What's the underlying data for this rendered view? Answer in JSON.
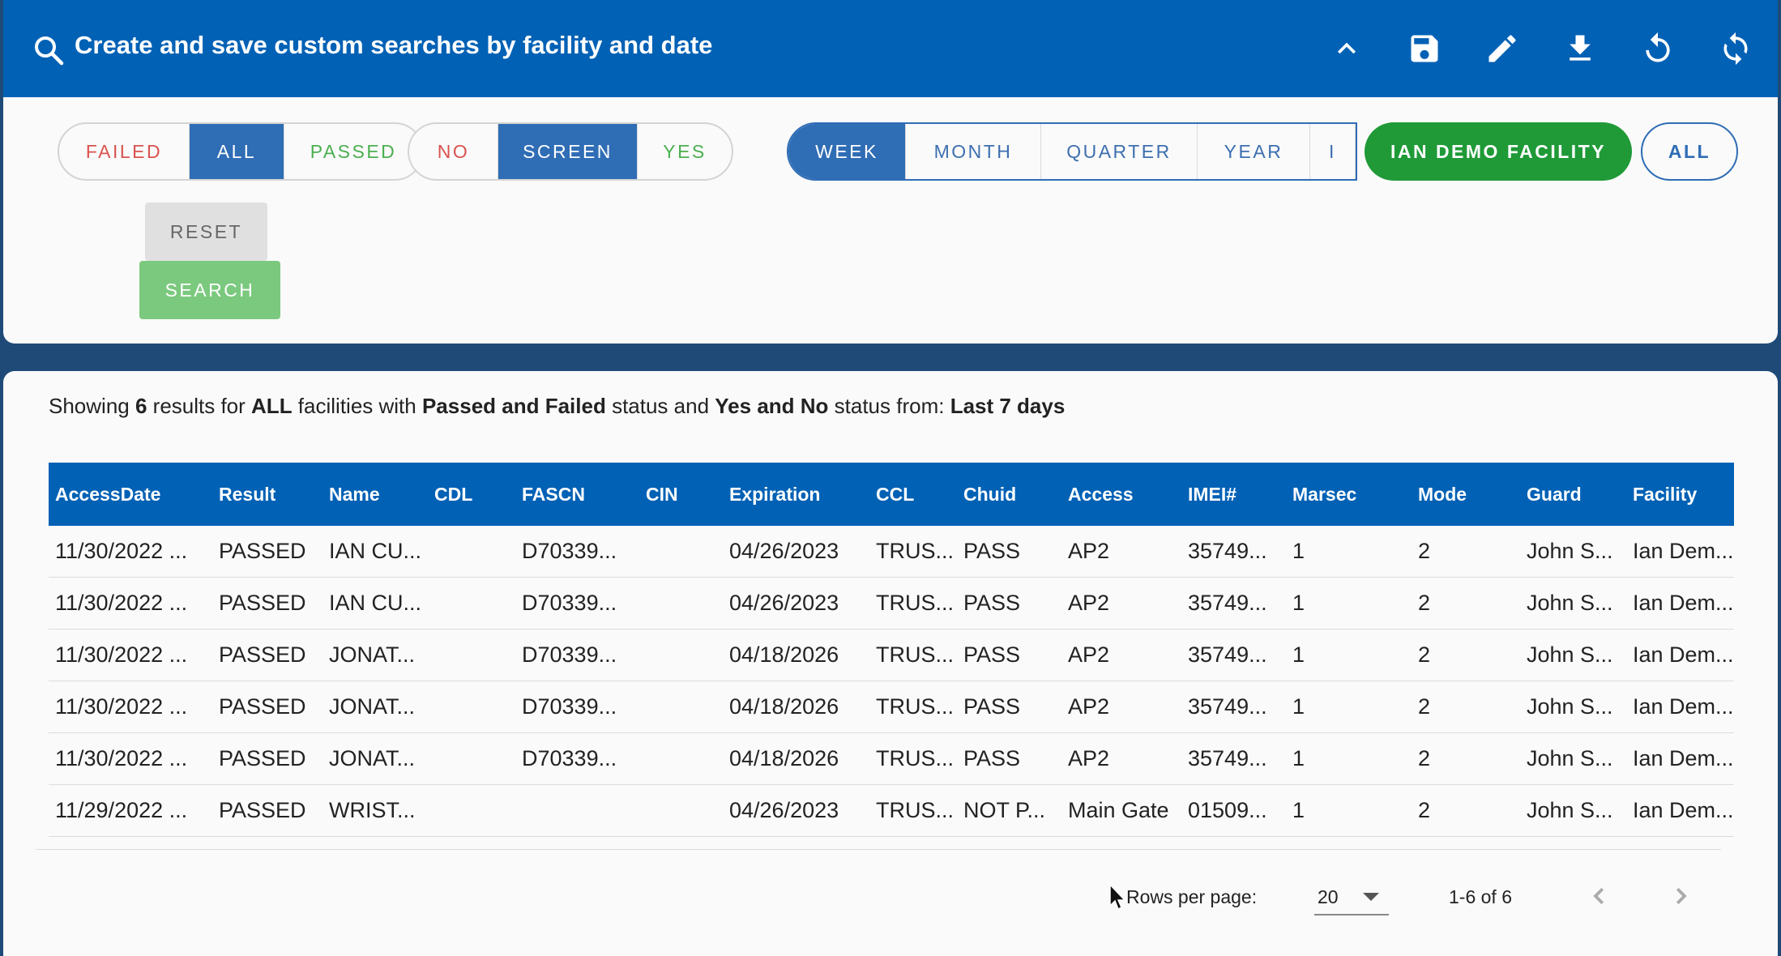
{
  "header": {
    "title": "Create and save custom searches by facility and date",
    "icons": [
      "search-icon",
      "collapse-chevron-icon",
      "save-icon",
      "edit-icon",
      "download-icon",
      "undo-icon",
      "refresh-icon"
    ]
  },
  "filters": {
    "result_group": [
      {
        "label": "FAILED",
        "selected": false,
        "color": "#d9534f"
      },
      {
        "label": "ALL",
        "selected": true
      },
      {
        "label": "PASSED",
        "selected": false,
        "color": "#4caf50"
      }
    ],
    "screen_group": [
      {
        "label": "NO",
        "selected": false,
        "color": "#d9534f"
      },
      {
        "label": "SCREEN",
        "selected": true
      },
      {
        "label": "YES",
        "selected": false,
        "color": "#4caf50"
      }
    ],
    "period_group": [
      {
        "label": "WEEK",
        "selected": true
      },
      {
        "label": "MONTH",
        "selected": false
      },
      {
        "label": "QUARTER",
        "selected": false
      },
      {
        "label": "YEAR",
        "selected": false
      },
      {
        "label": "I",
        "selected": false
      }
    ],
    "facility_label": "IAN DEMO FACILITY",
    "facility_all_label": "ALL",
    "reset_label": "RESET",
    "search_label": "SEARCH"
  },
  "summary": {
    "p1": "Showing ",
    "count": "6",
    "p2": " results for ",
    "facilities": "ALL",
    "p3": " facilities with ",
    "result_status": "Passed and Failed",
    "p4": " status and ",
    "screen_status": "Yes and No",
    "p5": " status from: ",
    "period": "Last 7 days"
  },
  "table": {
    "columns": [
      "AccessDate",
      "Result",
      "Name",
      "CDL",
      "FASCN",
      "CIN",
      "Expiration",
      "CCL",
      "Chuid",
      "Access",
      "IMEI#",
      "Marsec",
      "Mode",
      "Guard",
      "Facility"
    ],
    "rows": [
      [
        "11/30/2022 ...",
        "PASSED",
        "IAN CU...",
        "",
        "D70339...",
        "",
        "04/26/2023",
        "TRUS...",
        "PASS",
        "AP2",
        "35749...",
        "1",
        "2",
        "John S...",
        "Ian Dem..."
      ],
      [
        "11/30/2022 ...",
        "PASSED",
        "IAN CU...",
        "",
        "D70339...",
        "",
        "04/26/2023",
        "TRUS...",
        "PASS",
        "AP2",
        "35749...",
        "1",
        "2",
        "John S...",
        "Ian Dem..."
      ],
      [
        "11/30/2022 ...",
        "PASSED",
        "JONAT...",
        "",
        "D70339...",
        "",
        "04/18/2026",
        "TRUS...",
        "PASS",
        "AP2",
        "35749...",
        "1",
        "2",
        "John S...",
        "Ian Dem..."
      ],
      [
        "11/30/2022 ...",
        "PASSED",
        "JONAT...",
        "",
        "D70339...",
        "",
        "04/18/2026",
        "TRUS...",
        "PASS",
        "AP2",
        "35749...",
        "1",
        "2",
        "John S...",
        "Ian Dem..."
      ],
      [
        "11/30/2022 ...",
        "PASSED",
        "JONAT...",
        "",
        "D70339...",
        "",
        "04/18/2026",
        "TRUS...",
        "PASS",
        "AP2",
        "35749...",
        "1",
        "2",
        "John S...",
        "Ian Dem..."
      ],
      [
        "11/29/2022 ...",
        "PASSED",
        "WRIST...",
        "",
        "",
        "",
        "04/26/2023",
        "TRUS...",
        "NOT P...",
        "Main Gate",
        "01509...",
        "1",
        "2",
        "John S...",
        "Ian Dem..."
      ]
    ]
  },
  "pagination": {
    "rows_per_page_label": "Rows per page:",
    "rows_per_page_value": "20",
    "range": "1-6 of 6"
  },
  "colors": {
    "header_blue": "#0061b5",
    "selected_blue": "#2f6db5",
    "facility_green": "#1f9a37",
    "search_green": "#7bc97e"
  }
}
